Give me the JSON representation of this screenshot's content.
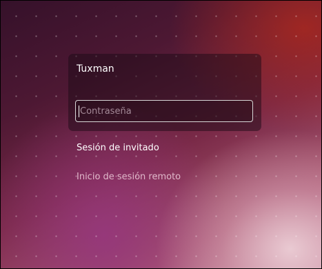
{
  "login": {
    "username": "Tuxman",
    "password_placeholder": "Contraseña"
  },
  "sessions": {
    "guest_label": "Sesión de invitado",
    "remote_label": "Inicio de sesión remoto"
  }
}
